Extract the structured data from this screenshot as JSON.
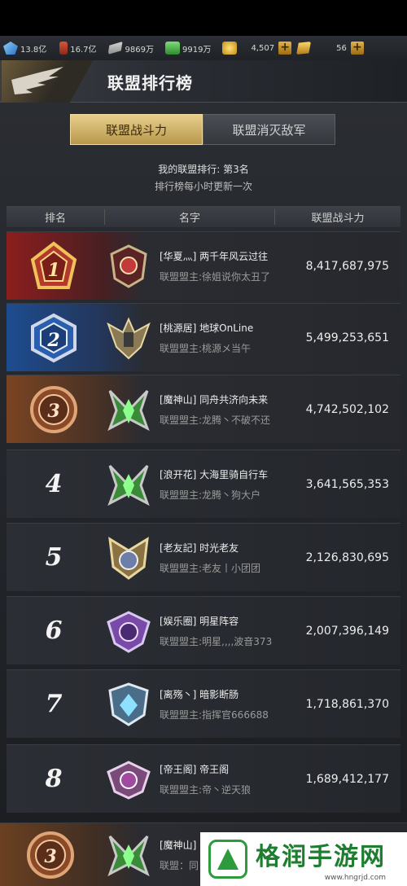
{
  "resources": [
    {
      "icon": "diamond-icon",
      "value": "13.8亿"
    },
    {
      "icon": "oil-icon",
      "value": "16.7亿"
    },
    {
      "icon": "steel-icon",
      "value": "9869万"
    },
    {
      "icon": "cash-icon",
      "value": "9919万"
    },
    {
      "icon": "coin-icon",
      "value": "4,507"
    },
    {
      "icon": "gold-bar-icon",
      "value": "56"
    }
  ],
  "header": {
    "title": "联盟排行榜"
  },
  "tabs": [
    {
      "label": "联盟战斗力",
      "active": true
    },
    {
      "label": "联盟消灭敌军",
      "active": false
    }
  ],
  "my_rank_text": "我的联盟排行: 第3名",
  "refresh_text": "排行榜每小时更新一次",
  "columns": {
    "rank": "排名",
    "name": "名字",
    "power": "联盟战斗力"
  },
  "rows": [
    {
      "rank": "1",
      "name": "[华夏灬] 两千年风云过往",
      "leader": "联盟盟主:徐姐说你太丑了",
      "power": "8,417,687,975"
    },
    {
      "rank": "2",
      "name": "[桃源居] 地球OnLine",
      "leader": "联盟盟主:桃源メ当午",
      "power": "5,499,253,651"
    },
    {
      "rank": "3",
      "name": "[魔神山] 同舟共济向未来",
      "leader": "联盟盟主:龙腾丶不破不还",
      "power": "4,742,502,102"
    },
    {
      "rank": "4",
      "name": "[浪开花] 大海里骑自行车",
      "leader": "联盟盟主:龙腾丶狗大户",
      "power": "3,641,565,353"
    },
    {
      "rank": "5",
      "name": "[老友記] 时光老友",
      "leader": "联盟盟主:老友丨小团团",
      "power": "2,126,830,695"
    },
    {
      "rank": "6",
      "name": "[娱乐圈] 明星阵容",
      "leader": "联盟盟主:明星,,,,波音373",
      "power": "2,007,396,149"
    },
    {
      "rank": "7",
      "name": "[离殇丶] 暗影断肠",
      "leader": "联盟盟主:指挥官666688",
      "power": "1,718,861,370"
    },
    {
      "rank": "8",
      "name": "[帝王阁] 帝王阁",
      "leader": "联盟盟主:帝丶逆天狼",
      "power": "1,689,412,177"
    },
    {
      "rank": "3",
      "name": "[魔神山]",
      "leader": "联盟：同",
      "power": ""
    }
  ],
  "watermark": {
    "text": "格润手游网",
    "url": "www.hngrjd.com"
  }
}
